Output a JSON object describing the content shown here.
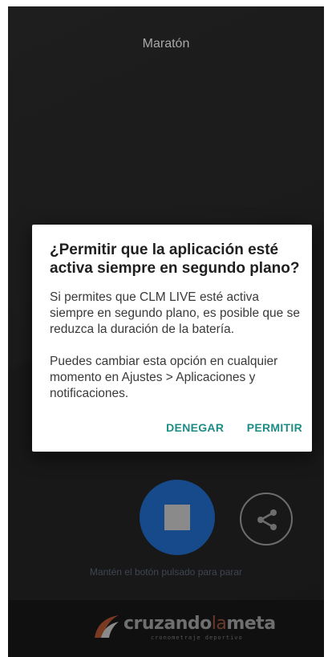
{
  "screen": {
    "title": "Maratón",
    "hint": "Mantén el botón pulsado para parar",
    "stop_icon": "stop-square-icon",
    "share_icon": "share-icon",
    "logo_text_a": "cruzando",
    "logo_text_b": "la",
    "logo_text_c": "meta",
    "logo_sub": "cronometraje deportivo"
  },
  "dialog": {
    "title": "¿Permitir que la aplicación esté activa siempre en segundo plano?",
    "body1": "Si permites que CLM LIVE esté activa siempre en segundo plano, es posible que se reduzca la duración de la batería.",
    "body2": "Puedes cambiar esta opción en cualquier momento en Ajustes > Aplicaciones y notificaciones.",
    "deny_label": "DENEGAR",
    "allow_label": "PERMITIR"
  },
  "colors": {
    "accent": "#1e8c86",
    "stop_button": "#174a8a"
  }
}
